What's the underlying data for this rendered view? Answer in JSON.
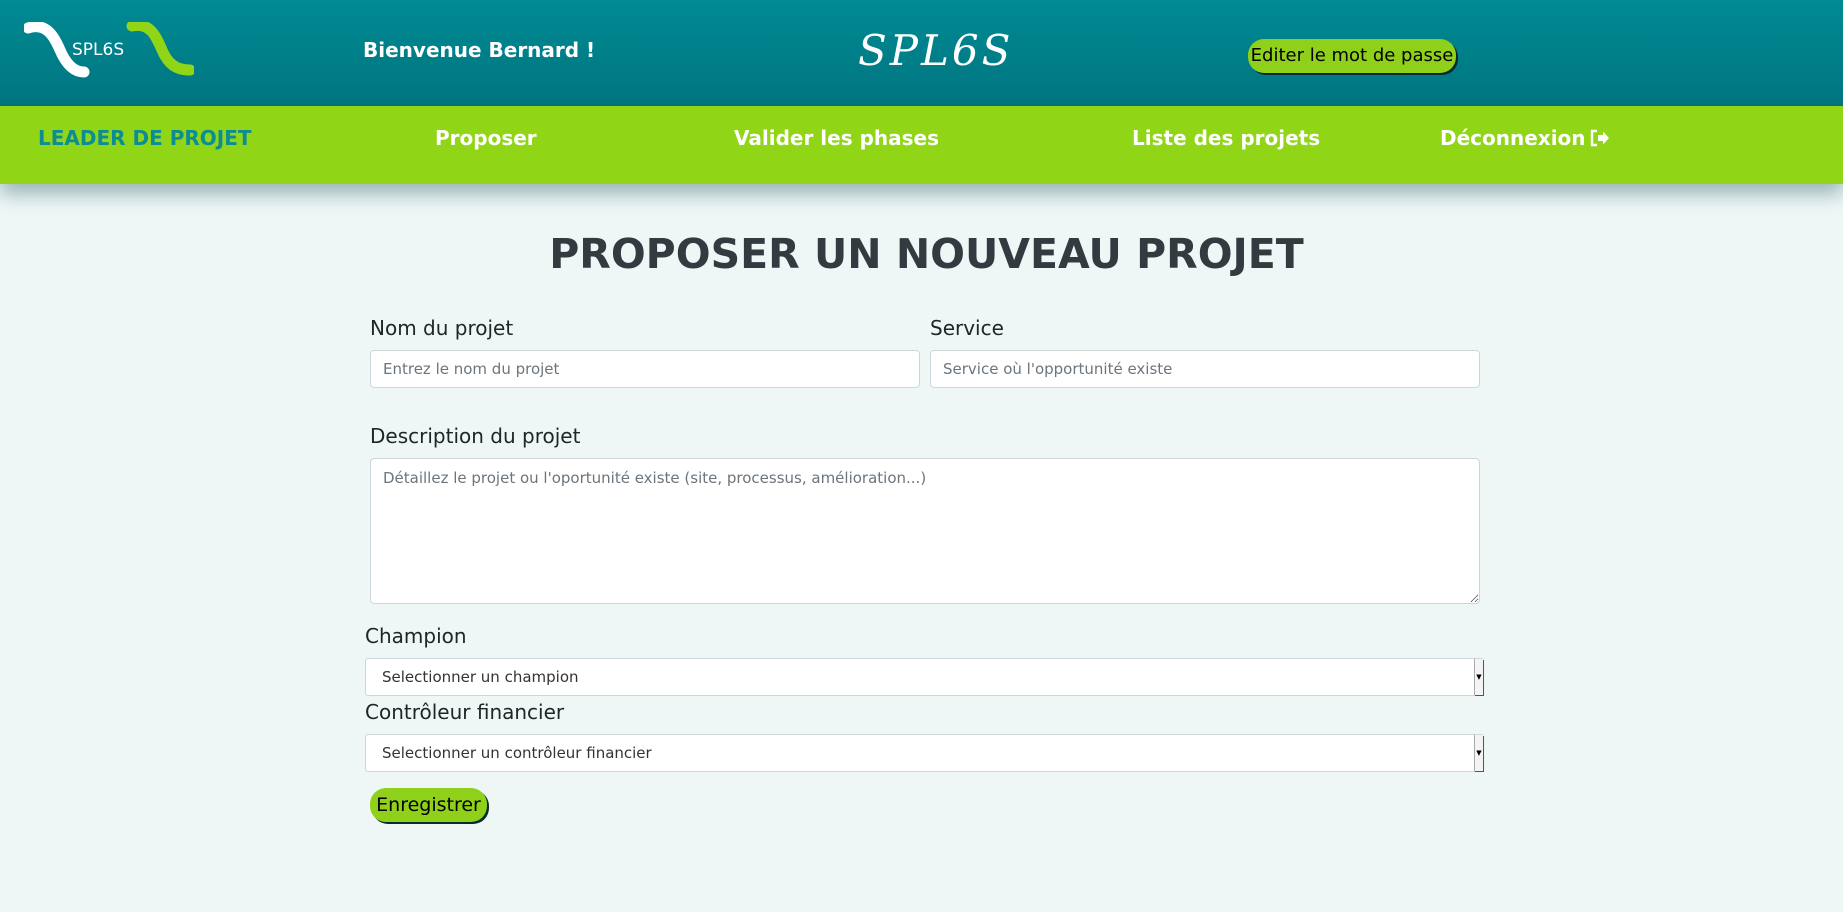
{
  "header": {
    "logo_text": "SPL6S",
    "welcome": "Bienvenue Bernard !",
    "brand": "SPL6S",
    "edit_password_label": "Editer le mot de passe"
  },
  "nav": {
    "role": "LEADER DE PROJET",
    "propose": "Proposer",
    "validate": "Valider les phases",
    "projects": "Liste des projets",
    "logout": "Déconnexion",
    "logout_icon": "sign-out-icon"
  },
  "form": {
    "title": "PROPOSER UN NOUVEAU PROJET",
    "name_label": "Nom du projet",
    "name_placeholder": "Entrez le nom du projet",
    "service_label": "Service",
    "service_placeholder": "Service où l'opportunité existe",
    "description_label": "Description du projet",
    "description_placeholder": "Détaillez le projet ou l'oportunité existe (site, processus, amélioration...)",
    "champion_label": "Champion",
    "champion_selected": "Selectionner un champion",
    "controller_label": "Contrôleur financier",
    "controller_selected": "Selectionner un contrôleur financier",
    "save_label": "Enregistrer"
  },
  "colors": {
    "header_bg": "#00858f",
    "nav_bg": "#91d517",
    "accent_green": "#8fd11a",
    "active_nav": "#0a8d94",
    "page_bg": "#eef7f6"
  }
}
